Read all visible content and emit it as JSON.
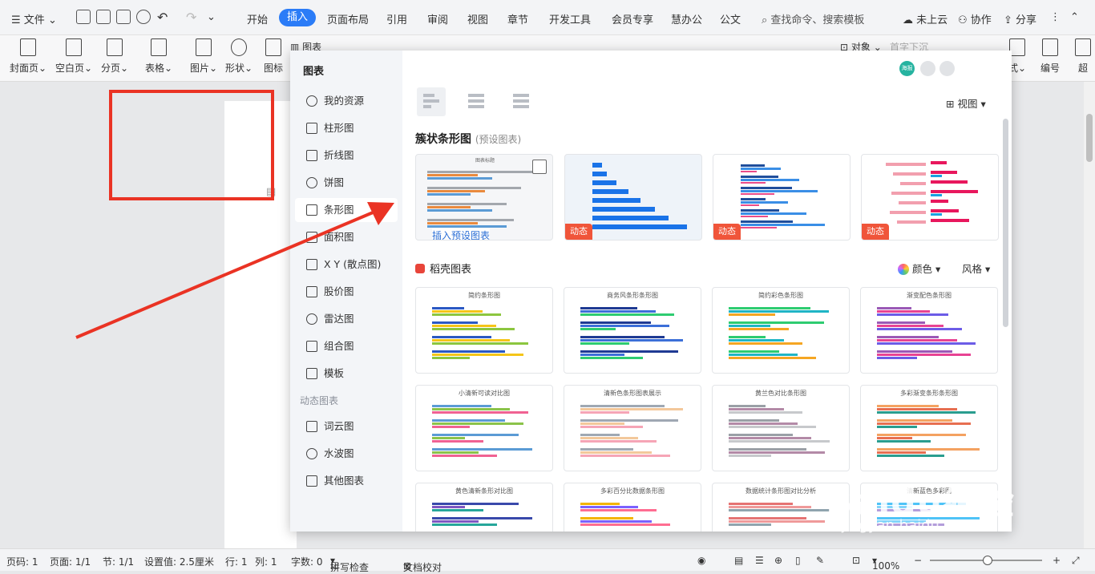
{
  "topbar": {
    "file_menu": "文件",
    "tabs": [
      "开始",
      "插入",
      "页面布局",
      "引用",
      "审阅",
      "视图",
      "章节",
      "开发工具",
      "会员专享",
      "慧办公",
      "公文"
    ],
    "search": "查找命令、搜索模板",
    "cloud": "未上云",
    "collab": "协作",
    "share": "分享"
  },
  "ribbon": {
    "items": [
      "封面页",
      "空白页",
      "分页",
      "表格",
      "图片",
      "形状",
      "图标"
    ],
    "chart": "图表",
    "object": "对象",
    "dropcap": "首字下沉",
    "right_items": [
      "式",
      "编号",
      "超"
    ]
  },
  "dialog": {
    "title": "图表",
    "sidebar": [
      {
        "label": "我的资源"
      },
      {
        "label": "柱形图"
      },
      {
        "label": "折线图"
      },
      {
        "label": "饼图"
      },
      {
        "label": "条形图"
      },
      {
        "label": "面积图"
      },
      {
        "label": "X Y (散点图)"
      },
      {
        "label": "股价图"
      },
      {
        "label": "雷达图"
      },
      {
        "label": "组合图"
      },
      {
        "label": "模板"
      }
    ],
    "dynamic_group": "动态图表",
    "dynamic_items": [
      {
        "label": "词云图"
      },
      {
        "label": "水波图"
      },
      {
        "label": "其他图表"
      }
    ],
    "view_label": "视图",
    "avatar_label": "海报",
    "section_title": "簇状条形图",
    "section_note": "(预设图表)",
    "preset_insert_label": "插入预设图表",
    "preset_chart_title": "图表标题",
    "badge_label": "动态",
    "daoke_title": "稻壳图表",
    "color_label": "颜色",
    "style_label": "风格",
    "gallery_titles": [
      "简约条形图",
      "商务风条形条形图",
      "简约彩色条形图",
      "渐变配色条形图",
      "小清新可读对比图",
      "清新色条形图表展示",
      "黄兰色对比条形图",
      "多彩渐变条形条形图",
      "黄色清新条形对比图",
      "多彩百分比数据条形图",
      "数据统计条形图对比分析",
      "清新蓝色多彩图"
    ]
  },
  "statusbar": {
    "page": "页码: 1",
    "pages": "页面: 1/1",
    "section": "节: 1/1",
    "setting": "设置值: 2.5厘米",
    "row": "行: 1",
    "col": "列: 1",
    "words": "字数: 0",
    "spell": "拼写检查",
    "proof": "文档校对",
    "zoom": "100%"
  },
  "watermark": {
    "brand": "Baidu经验",
    "url": "jingyan.baidu.com"
  },
  "colors": {
    "accent": "#2b7cf7",
    "highlight": "#ea3324",
    "badge": "#f0553a"
  }
}
